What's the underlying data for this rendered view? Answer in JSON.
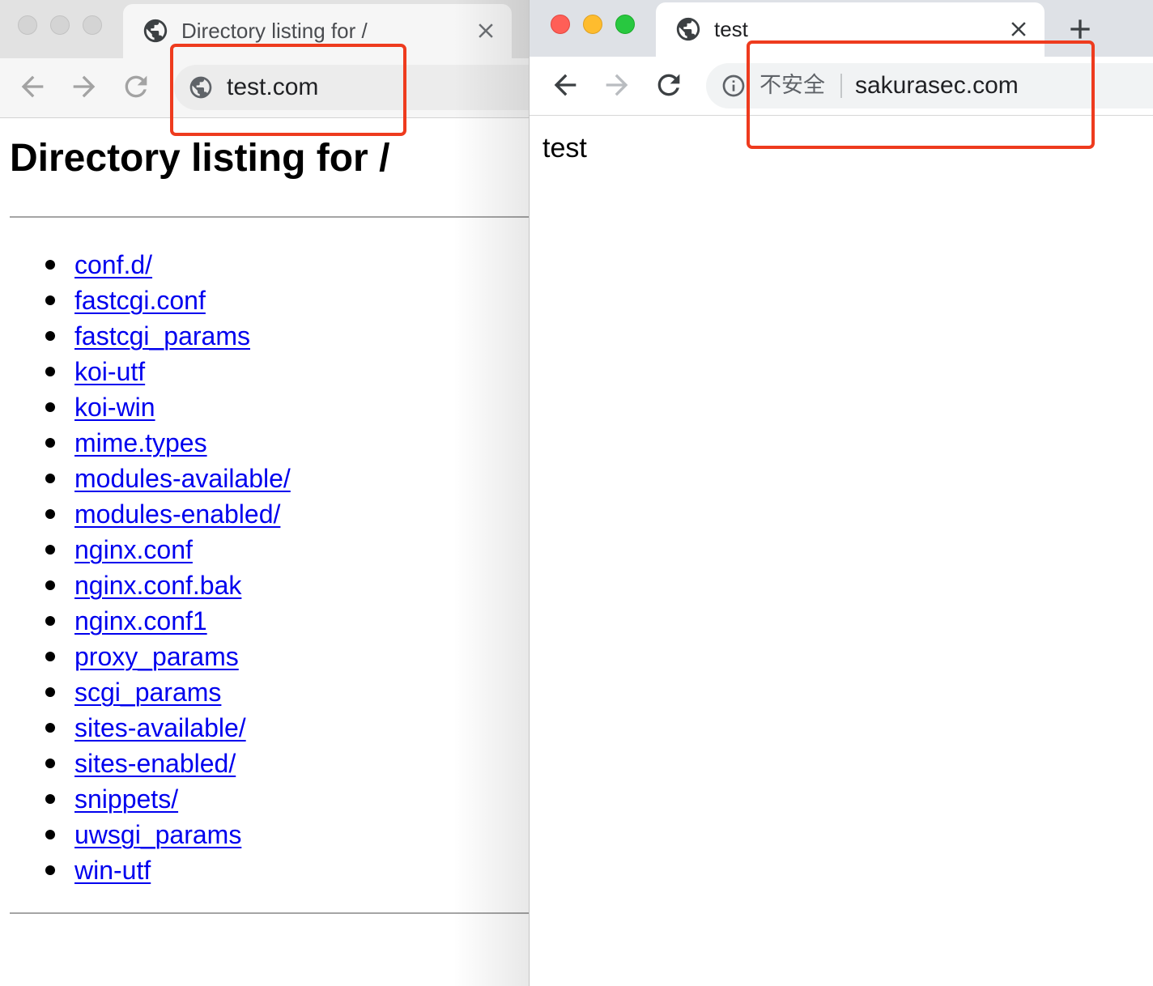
{
  "left_window": {
    "tab": {
      "title": "Directory listing for /",
      "favicon_icon": "globe-icon",
      "close_icon": "close-icon"
    },
    "toolbar": {
      "back_icon": "arrow-back-icon",
      "forward_icon": "arrow-forward-icon",
      "reload_icon": "reload-icon"
    },
    "address_bar": {
      "site_icon": "globe-icon",
      "url": "test.com"
    },
    "page": {
      "heading": "Directory listing for /",
      "entries": [
        "conf.d/",
        "fastcgi.conf",
        "fastcgi_params",
        "koi-utf",
        "koi-win",
        "mime.types",
        "modules-available/",
        "modules-enabled/",
        "nginx.conf",
        "nginx.conf.bak",
        "nginx.conf1",
        "proxy_params",
        "scgi_params",
        "sites-available/",
        "sites-enabled/",
        "snippets/",
        "uwsgi_params",
        "win-utf"
      ]
    }
  },
  "right_window": {
    "tab": {
      "title": "test",
      "favicon_icon": "globe-icon",
      "close_icon": "close-icon"
    },
    "new_tab_icon": "plus-icon",
    "toolbar": {
      "back_icon": "arrow-back-icon",
      "forward_icon": "arrow-forward-icon",
      "reload_icon": "reload-icon"
    },
    "address_bar": {
      "security_icon": "info-icon",
      "security_label": "不安全",
      "url": "sakurasec.com"
    },
    "page": {
      "body_text": "test"
    }
  },
  "colors": {
    "link": "#0000ee",
    "annotation-box": "#ee3b1e",
    "light-close": "#ff5f57",
    "light-minimize": "#febc2e",
    "light-zoom": "#28c840",
    "light-inactive": "#d4d4d4"
  }
}
